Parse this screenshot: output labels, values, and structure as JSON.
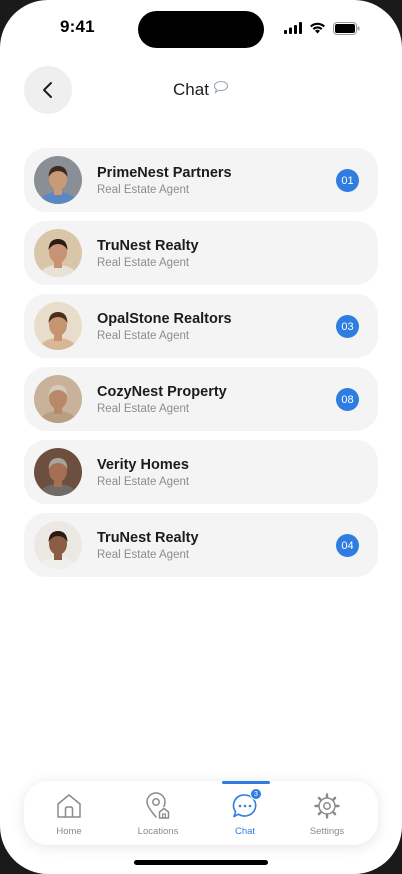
{
  "status_bar": {
    "time": "9:41"
  },
  "header": {
    "title": "Chat",
    "back_icon": "chevron-left-icon",
    "title_icon": "speech-bubble-icon"
  },
  "chats": [
    {
      "name": "PrimeNest Partners",
      "role": "Real Estate Agent",
      "unread": "01",
      "avatar_bg": "#8a8f96",
      "skin": "#c99a78",
      "hair": "#3a2a22",
      "shirt": "#5b87c2"
    },
    {
      "name": "TruNest Realty",
      "role": "Real Estate Agent",
      "unread": "",
      "avatar_bg": "#d9c6a8",
      "skin": "#c89374",
      "hair": "#2a1d16",
      "shirt": "#e9e2d6"
    },
    {
      "name": "OpalStone Realtors",
      "role": "Real Estate Agent",
      "unread": "03",
      "avatar_bg": "#e8dccb",
      "skin": "#c79471",
      "hair": "#4a2f20",
      "shirt": "#d8b796"
    },
    {
      "name": "CozyNest Property",
      "role": "Real Estate Agent",
      "unread": "08",
      "avatar_bg": "#c8b29a",
      "skin": "#b9876a",
      "hair": "#d6cabb",
      "shirt": "#b89e83"
    },
    {
      "name": "Verity Homes",
      "role": "Real Estate Agent",
      "unread": "",
      "avatar_bg": "#6c4f3e",
      "skin": "#a46f52",
      "hair": "#a9a39a",
      "shirt": "#6d6a68"
    },
    {
      "name": "TruNest Realty",
      "role": "Real Estate Agent",
      "unread": "04",
      "avatar_bg": "#ece8e4",
      "skin": "#8b5d45",
      "hair": "#2a1b14",
      "shirt": "#f1efec"
    }
  ],
  "bottom_nav": {
    "items": [
      {
        "label": "Home",
        "icon": "home-icon"
      },
      {
        "label": "Locations",
        "icon": "location-pin-icon"
      },
      {
        "label": "Chat",
        "icon": "chat-bubble-icon",
        "badge": "3"
      },
      {
        "label": "Settings",
        "icon": "gear-icon"
      }
    ],
    "active": "Chat"
  },
  "colors": {
    "accent": "#2f7de1",
    "card": "#f4f4f4",
    "muted_text": "#8d8d8d"
  }
}
